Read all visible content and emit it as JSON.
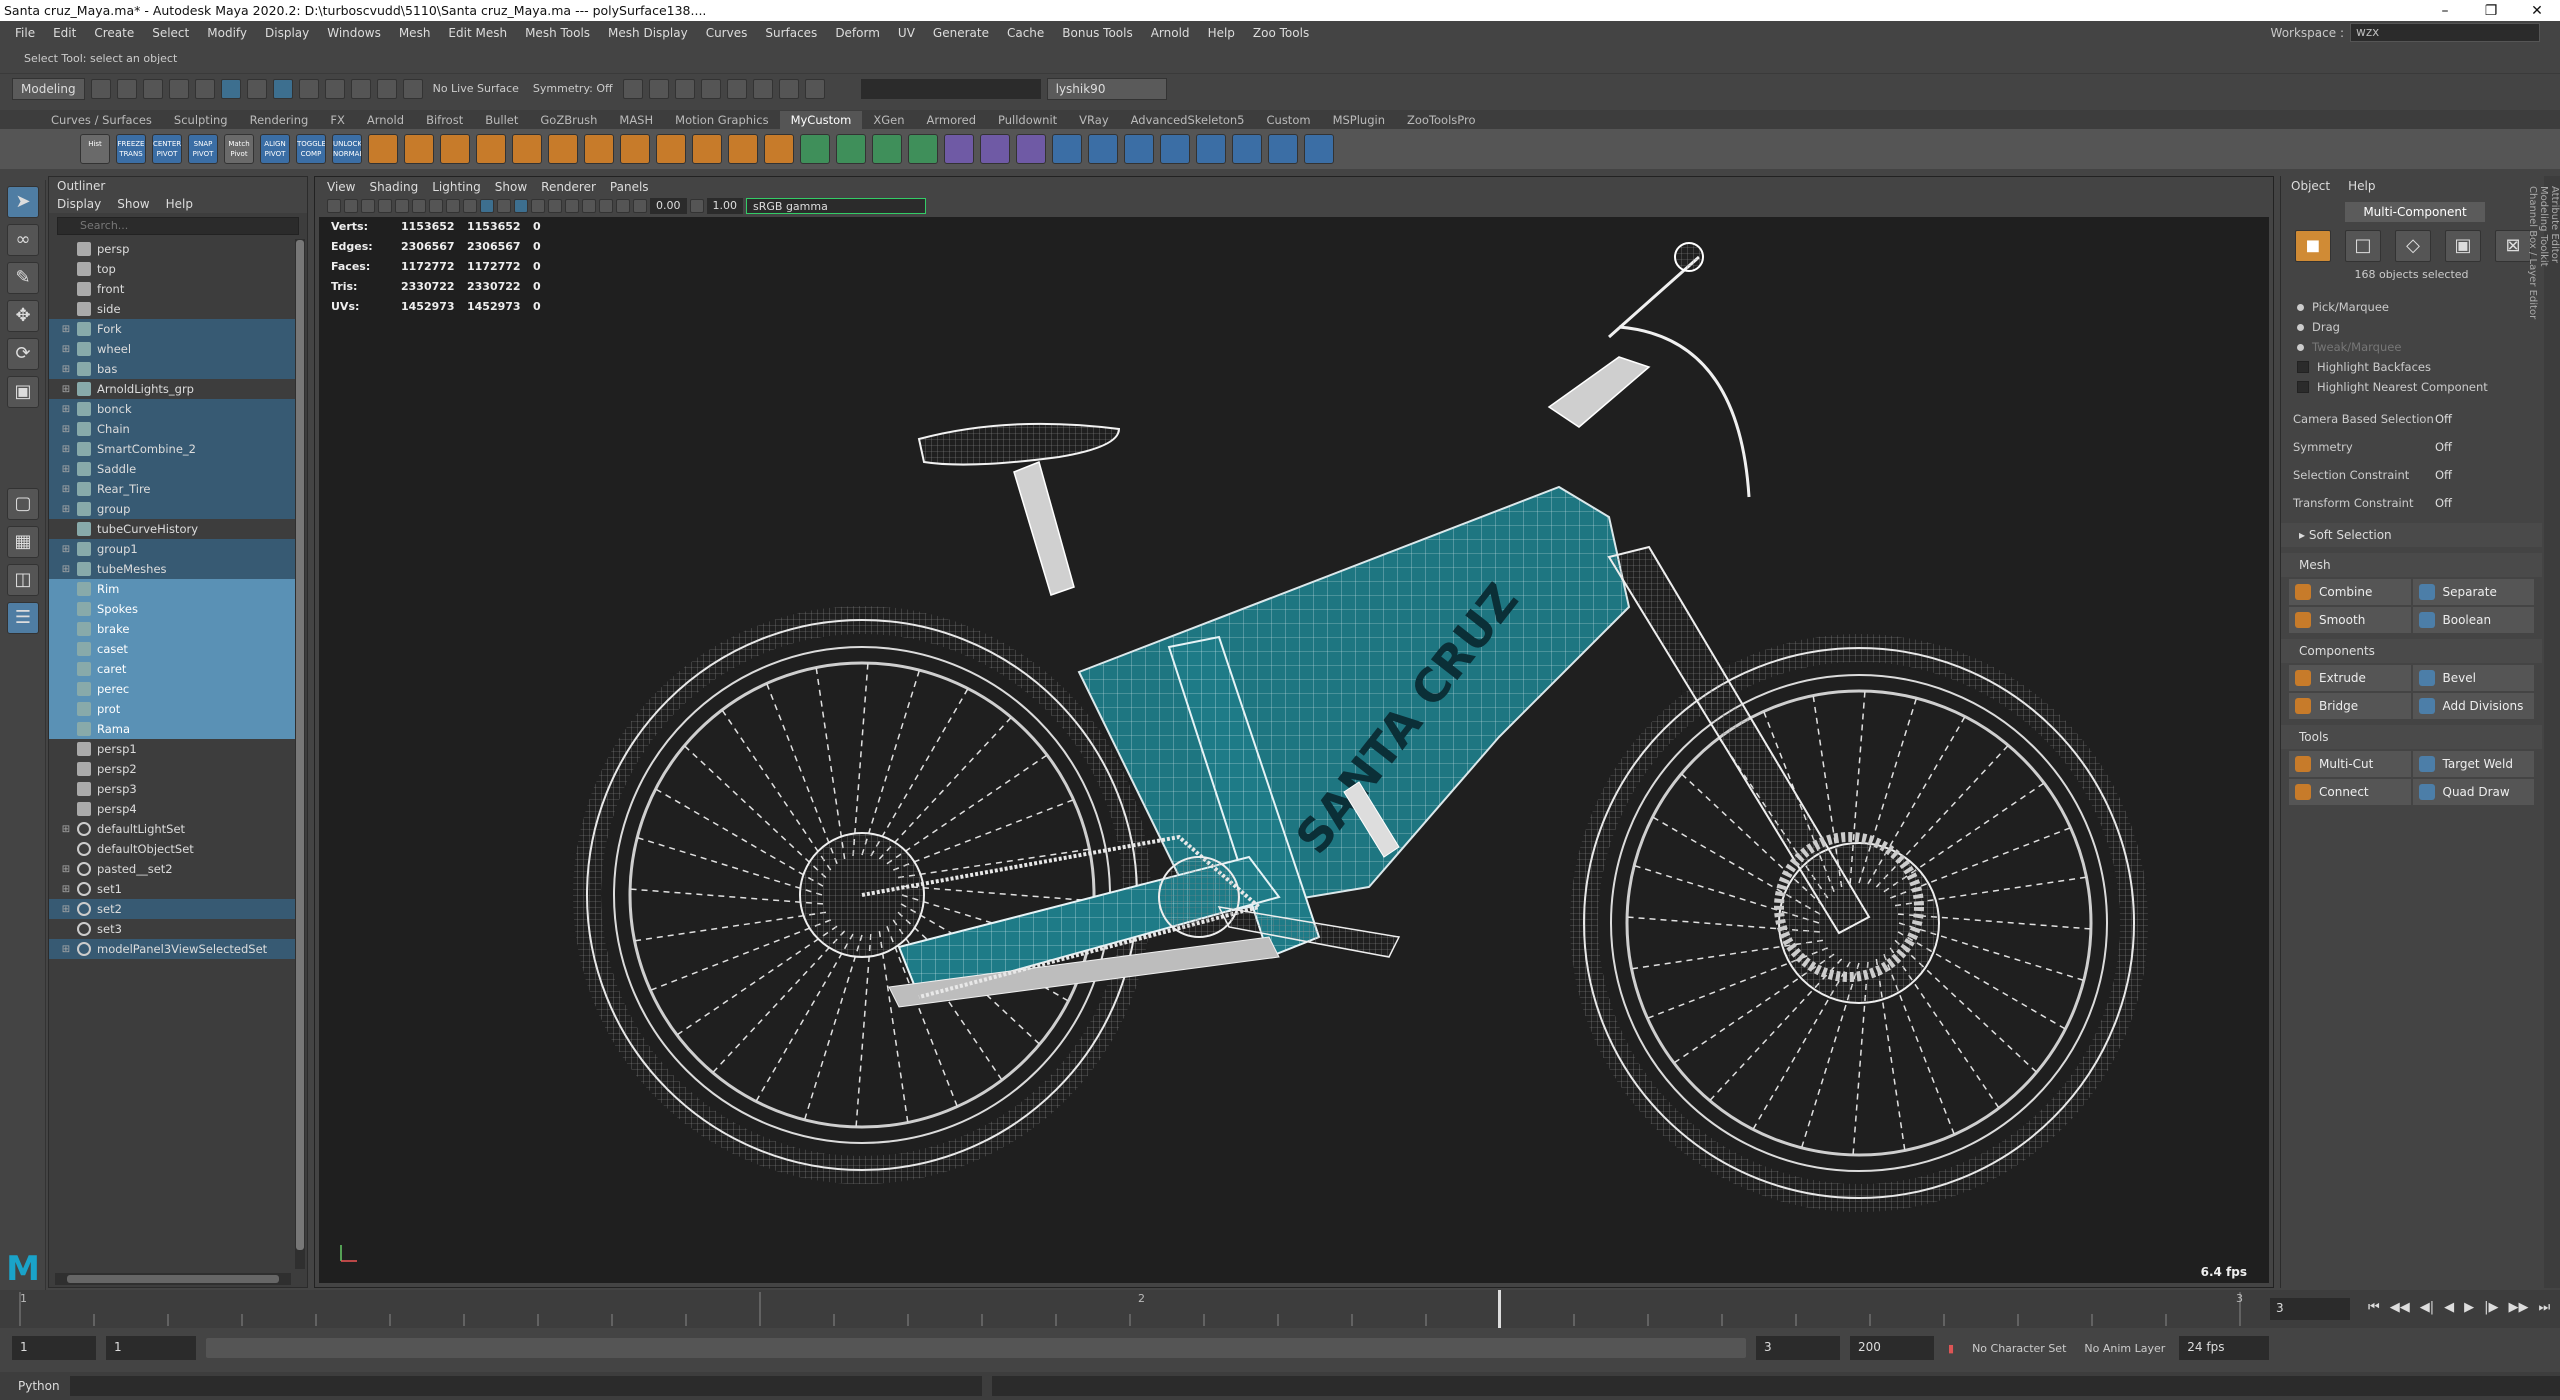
{
  "titlebar": {
    "title": "Santa cruz_Maya.ma* - Autodesk Maya 2020.2: D:\\turboscvudd\\5110\\Santa cruz_Maya.ma   ---   polySurface138...."
  },
  "menubar": [
    "File",
    "Edit",
    "Create",
    "Select",
    "Modify",
    "Display",
    "Windows",
    "Mesh",
    "Edit Mesh",
    "Mesh Tools",
    "Mesh Display",
    "Curves",
    "Surfaces",
    "Deform",
    "UV",
    "Generate",
    "Cache",
    "Bonus Tools",
    "Arnold",
    "Help",
    "Zoo Tools"
  ],
  "workspace": {
    "label": "Workspace :",
    "value": "wzx"
  },
  "helpline": "Select Tool: select an object",
  "statusline": {
    "mode": "Modeling",
    "live": "No Live Surface",
    "symmetry": "Symmetry: Off",
    "user": "lyshik90"
  },
  "shelf": {
    "tabs": [
      "Curves / Surfaces",
      "Sculpting",
      "Rendering",
      "FX",
      "Arnold",
      "Bifrost",
      "Bullet",
      "GoZBrush",
      "MASH",
      "Motion Graphics",
      "MyCustom",
      "XGen",
      "Armored",
      "Pulldownit",
      "VRay",
      "AdvancedSkeleton5",
      "Custom",
      "MSPlugin",
      "ZooToolsPro"
    ],
    "active": "MyCustom",
    "icons": [
      "Hist",
      "FREEZE TRANS",
      "CENTER PIVOT",
      "SNAP PIVOT",
      "Match Pivot",
      "ALIGN PIVOT",
      "TOGGLE COMP",
      "UNLOCK NORMALS"
    ]
  },
  "outliner": {
    "title": "Outliner",
    "menus": [
      "Display",
      "Show",
      "Help"
    ],
    "search_placeholder": "Search...",
    "rows": [
      {
        "name": "persp",
        "type": "cam",
        "state": ""
      },
      {
        "name": "top",
        "type": "cam",
        "state": ""
      },
      {
        "name": "front",
        "type": "cam",
        "state": ""
      },
      {
        "name": "side",
        "type": "cam",
        "state": ""
      },
      {
        "name": "Fork",
        "type": "grp",
        "state": "hl",
        "expand": true
      },
      {
        "name": "wheel",
        "type": "grp",
        "state": "hl",
        "expand": true
      },
      {
        "name": "bas",
        "type": "grp",
        "state": "hl",
        "expand": true
      },
      {
        "name": "ArnoldLights_grp",
        "type": "grp",
        "state": "",
        "expand": true
      },
      {
        "name": "bonck",
        "type": "grp",
        "state": "hl",
        "expand": true
      },
      {
        "name": "Chain",
        "type": "grp",
        "state": "hl",
        "expand": true
      },
      {
        "name": "SmartCombine_2",
        "type": "grp",
        "state": "hl",
        "expand": true
      },
      {
        "name": "Saddle",
        "type": "grp",
        "state": "hl",
        "expand": true
      },
      {
        "name": "Rear_Tire",
        "type": "grp",
        "state": "hl",
        "expand": true
      },
      {
        "name": "group",
        "type": "grp",
        "state": "hl",
        "expand": true
      },
      {
        "name": "tubeCurveHistory",
        "type": "grp",
        "state": ""
      },
      {
        "name": "group1",
        "type": "grp",
        "state": "hl",
        "expand": true
      },
      {
        "name": "tubeMeshes",
        "type": "grp",
        "state": "hl",
        "expand": true
      },
      {
        "name": "Rim",
        "type": "mesh",
        "state": "sel"
      },
      {
        "name": "Spokes",
        "type": "mesh",
        "state": "sel"
      },
      {
        "name": "brake",
        "type": "mesh",
        "state": "sel"
      },
      {
        "name": "caset",
        "type": "mesh",
        "state": "sel"
      },
      {
        "name": "caret",
        "type": "mesh",
        "state": "sel"
      },
      {
        "name": "perec",
        "type": "mesh",
        "state": "sel"
      },
      {
        "name": "prot",
        "type": "mesh",
        "state": "sel"
      },
      {
        "name": "Rama",
        "type": "mesh",
        "state": "sel"
      },
      {
        "name": "persp1",
        "type": "cam",
        "state": ""
      },
      {
        "name": "persp2",
        "type": "cam",
        "state": ""
      },
      {
        "name": "persp3",
        "type": "cam",
        "state": ""
      },
      {
        "name": "persp4",
        "type": "cam",
        "state": ""
      },
      {
        "name": "defaultLightSet",
        "type": "set",
        "state": "",
        "expand": true
      },
      {
        "name": "defaultObjectSet",
        "type": "set",
        "state": ""
      },
      {
        "name": "pasted__set2",
        "type": "set",
        "state": "",
        "expand": true
      },
      {
        "name": "set1",
        "type": "set",
        "state": "",
        "expand": true
      },
      {
        "name": "set2",
        "type": "set",
        "state": "hl",
        "expand": true
      },
      {
        "name": "set3",
        "type": "set",
        "state": ""
      },
      {
        "name": "modelPanel3ViewSelectedSet",
        "type": "set",
        "state": "hl",
        "expand": true
      }
    ]
  },
  "viewport": {
    "menus": [
      "View",
      "Shading",
      "Lighting",
      "Show",
      "Renderer",
      "Panels"
    ],
    "exposure": "0.00",
    "gamma": "1.00",
    "colorspace": "sRGB gamma",
    "hud": [
      {
        "label": "Verts:",
        "a": "1153652",
        "b": "1153652",
        "c": "0"
      },
      {
        "label": "Edges:",
        "a": "2306567",
        "b": "2306567",
        "c": "0"
      },
      {
        "label": "Faces:",
        "a": "1172772",
        "b": "1172772",
        "c": "0"
      },
      {
        "label": "Tris:",
        "a": "2330722",
        "b": "2330722",
        "c": "0"
      },
      {
        "label": "UVs:",
        "a": "1452973",
        "b": "1452973",
        "c": "0"
      }
    ],
    "fps": "6.4 fps",
    "frame_text": "SANTA CRUZ"
  },
  "toolkit": {
    "tabs": [
      "Object",
      "Help"
    ],
    "mode_button": "Multi-Component",
    "selected_count": "168 objects selected",
    "pick": [
      "Pick/Marquee",
      "Drag",
      "Tweak/Marquee"
    ],
    "checks": [
      "Highlight Backfaces",
      "Highlight Nearest Component"
    ],
    "settings": [
      {
        "k": "Camera Based Selection",
        "v": "Off"
      },
      {
        "k": "Symmetry",
        "v": "Off"
      },
      {
        "k": "Selection Constraint",
        "v": "Off"
      },
      {
        "k": "Transform Constraint",
        "v": "Off"
      }
    ],
    "soft_selection": "Soft Selection",
    "sections": [
      {
        "title": "Mesh",
        "buttons": [
          "Combine",
          "Separate",
          "Smooth",
          "Boolean"
        ]
      },
      {
        "title": "Components",
        "buttons": [
          "Extrude",
          "Bevel",
          "Bridge",
          "Add Divisions"
        ]
      },
      {
        "title": "Tools",
        "buttons": [
          "Multi-Cut",
          "Target Weld",
          "Connect",
          "Quad Draw"
        ]
      }
    ],
    "side_tabs": [
      "Attribute Editor",
      "Modeling Toolkit",
      "Channel Box / Layer Editor"
    ]
  },
  "timeline": {
    "ticks": [
      "1",
      "2",
      "3"
    ],
    "current_frame": "3",
    "range_start": "1",
    "range_start2": "1",
    "range_end_inner": "3",
    "range_end": "200",
    "char_set": "No Character Set",
    "anim_layer": "No Anim Layer",
    "fps": "24 fps"
  },
  "cmdline": {
    "lang": "Python"
  }
}
